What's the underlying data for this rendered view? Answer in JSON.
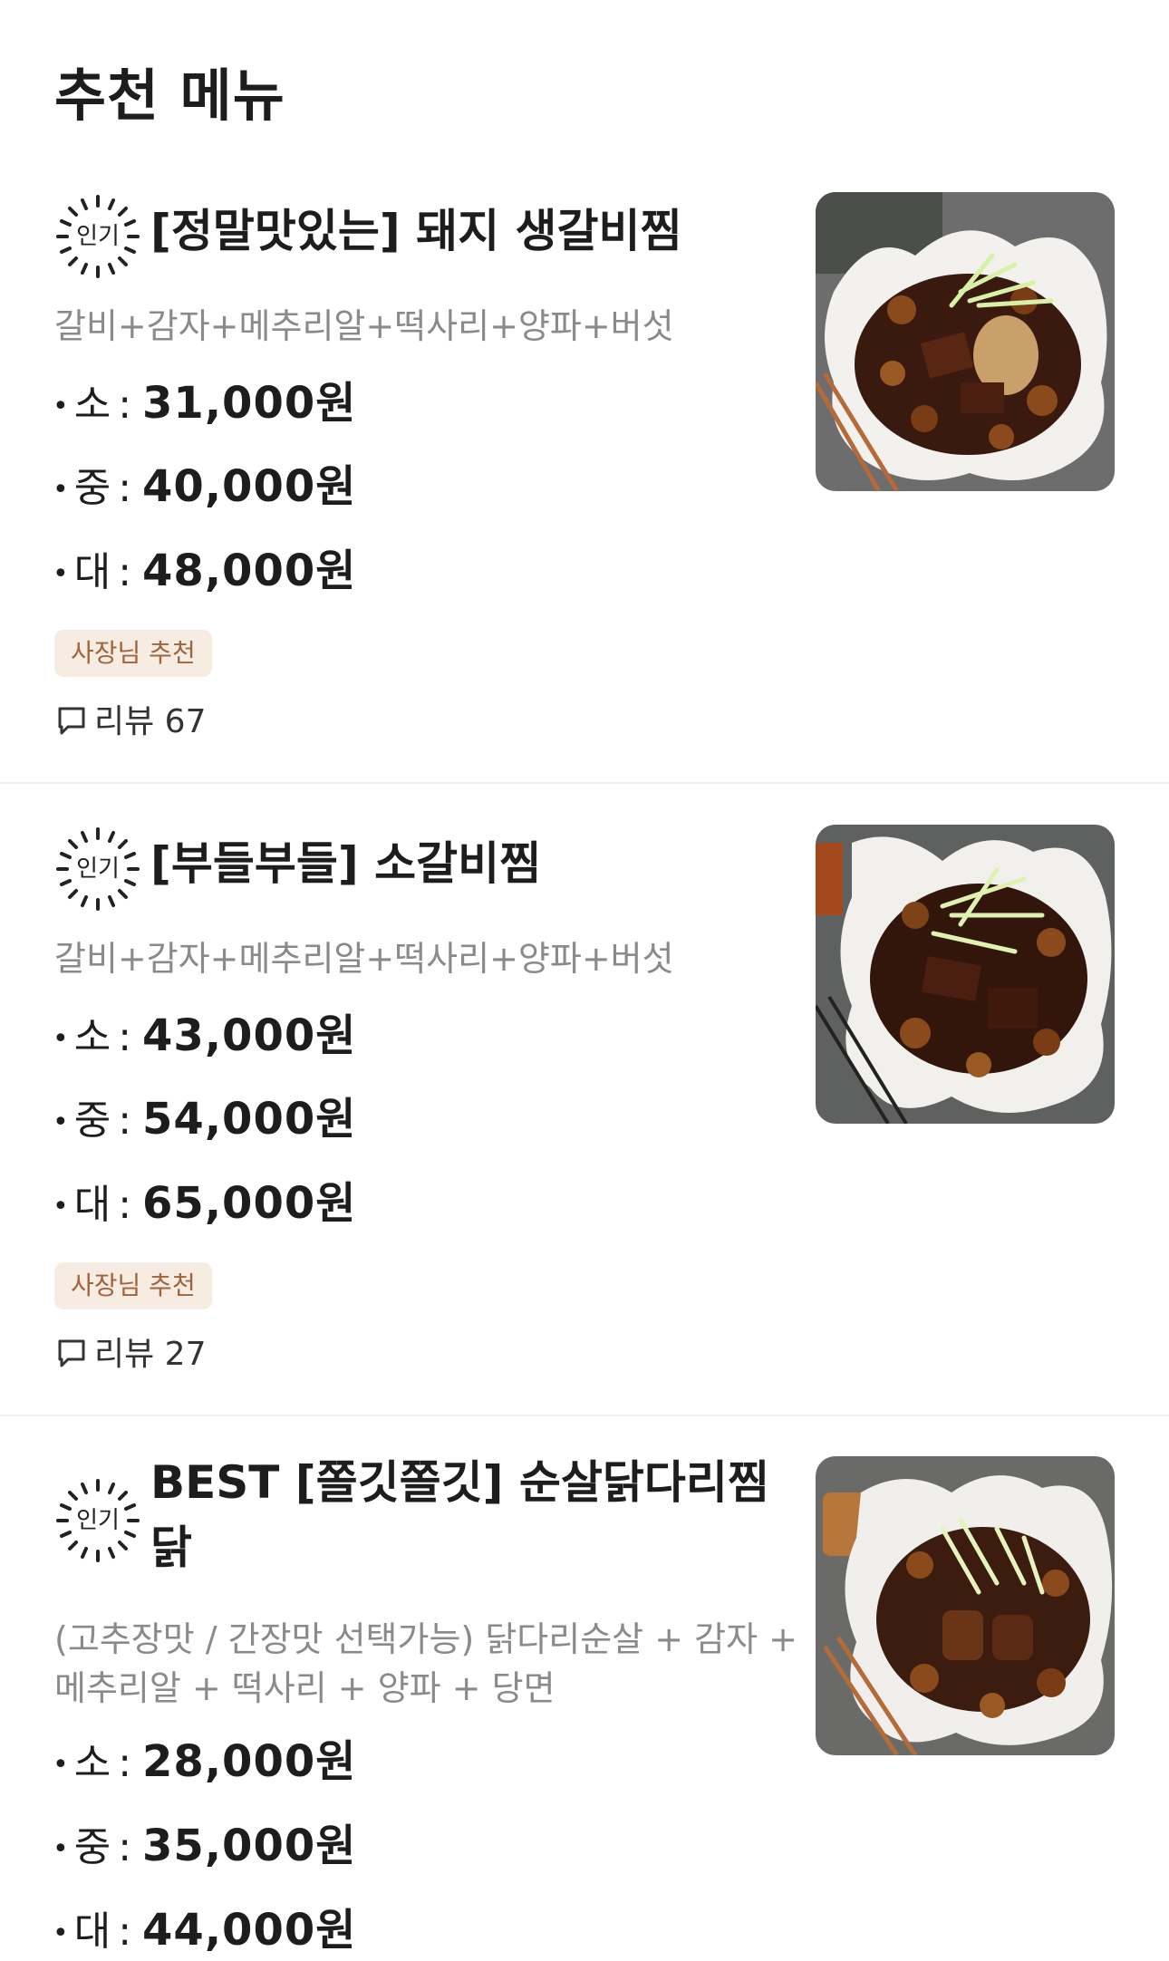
{
  "page": {
    "title": "추천 메뉴"
  },
  "menu_items": [
    {
      "badge": "인기",
      "name": "[정말맛있는] 돼지 생갈비찜",
      "description": "갈비+감자+메추리알+떡사리+양파+버섯",
      "prices": [
        {
          "bullet": "•",
          "size": "소",
          "colon": ":",
          "price": "31,000원"
        },
        {
          "bullet": "•",
          "size": "중",
          "colon": ":",
          "price": "40,000원"
        },
        {
          "bullet": "•",
          "size": "대",
          "colon": ":",
          "price": "48,000원"
        }
      ],
      "tag": "사장님 추천",
      "review_label": "리뷰 67"
    },
    {
      "badge": "인기",
      "name": "[부들부들] 소갈비찜",
      "description": "갈비+감자+메추리알+떡사리+양파+버섯",
      "prices": [
        {
          "bullet": "•",
          "size": "소",
          "colon": ":",
          "price": "43,000원"
        },
        {
          "bullet": "•",
          "size": "중",
          "colon": ":",
          "price": "54,000원"
        },
        {
          "bullet": "•",
          "size": "대",
          "colon": ":",
          "price": "65,000원"
        }
      ],
      "tag": "사장님 추천",
      "review_label": "리뷰 27"
    },
    {
      "badge": "인기",
      "name": "BEST [쫄깃쫄깃] 순살닭다리찜닭",
      "description": "(고추장맛 / 간장맛 선택가능) 닭다리순살 + 감자 + 메추리알 + 떡사리 + 양파 + 당면",
      "prices": [
        {
          "bullet": "•",
          "size": "소",
          "colon": ":",
          "price": "28,000원"
        },
        {
          "bullet": "•",
          "size": "중",
          "colon": ":",
          "price": "35,000원"
        },
        {
          "bullet": "•",
          "size": "대",
          "colon": ":",
          "price": "44,000원"
        }
      ]
    }
  ],
  "icons": {
    "badge": "popular-badge-icon",
    "review": "speech-bubble-icon"
  },
  "colors": {
    "tag_background": "#f7ece2",
    "tag_text": "#a0643c",
    "description_text": "#8a8a8a",
    "divider": "#f0f0f0"
  }
}
